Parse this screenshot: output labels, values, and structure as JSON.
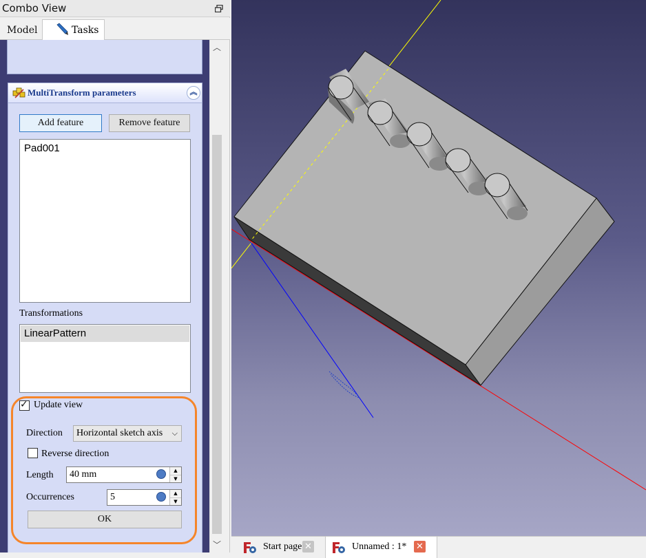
{
  "combo": {
    "title": "Combo View",
    "tabs": [
      {
        "label": "Model"
      },
      {
        "label": "Tasks",
        "icon": "pencil-icon"
      }
    ]
  },
  "params": {
    "title": "MultiTransform parameters",
    "add_feature_label": "Add feature",
    "remove_feature_label": "Remove feature",
    "features": [
      "Pad001"
    ],
    "transformations_label": "Transformations",
    "transformations": [
      "LinearPattern"
    ],
    "update_view_label": "Update view",
    "update_view_checked": true,
    "direction_label": "Direction",
    "direction_value": "Horizontal sketch axis",
    "reverse_label": "Reverse direction",
    "reverse_checked": false,
    "length_label": "Length",
    "length_value": "40 mm",
    "occurrences_label": "Occurrences",
    "occurrences_value": "5",
    "ok_label": "OK"
  },
  "doc_tabs": [
    {
      "label": "Start page",
      "active": false
    },
    {
      "label": "Unnamed : 1*",
      "active": true
    }
  ],
  "colors": {
    "highlight_ring": "#f5852a",
    "axis_x": "#ff0000",
    "axis_y": "#ffff00",
    "axis_z": "#0000ff"
  }
}
